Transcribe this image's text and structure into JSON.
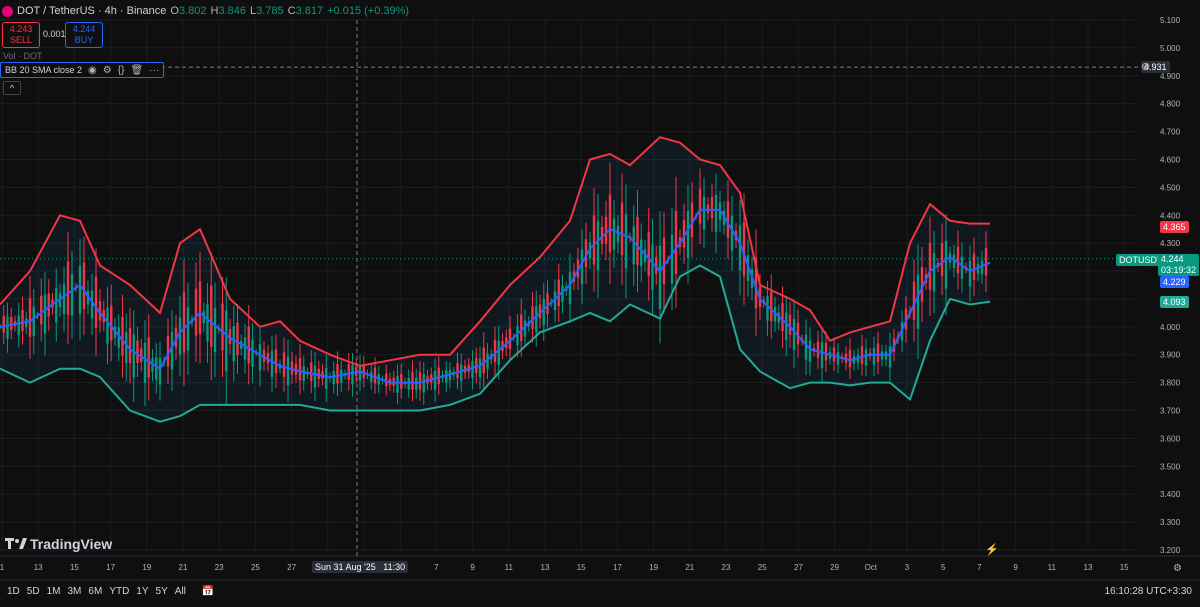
{
  "header": {
    "symbol": "DOT / TetherUS · 4h · Binance",
    "ohlc": [
      {
        "label": "O",
        "value": "3.802"
      },
      {
        "label": "H",
        "value": "3.846"
      },
      {
        "label": "L",
        "value": "3.785"
      },
      {
        "label": "C",
        "value": "3.817"
      }
    ],
    "change": "+0.015 (+0.39%)",
    "sell_price": "4.243",
    "sell_label": "SELL",
    "spread": "0.001",
    "buy_price": "4.244",
    "buy_label": "BUY",
    "volume_label": "Vol · DOT",
    "indicator_label": "BB 20 SMA close 2"
  },
  "price_labels": {
    "symbol_tag": "DOTUSDT",
    "last": "4.244",
    "countdown": "03:19:32",
    "upper": "4.365",
    "middle": "4.229",
    "lower": "4.093",
    "crosshair": "4.931"
  },
  "bottom": {
    "ranges": [
      "1D",
      "5D",
      "1M",
      "3M",
      "6M",
      "YTD",
      "1Y",
      "5Y",
      "All"
    ],
    "clock": "16:10:28 UTC+3:30",
    "crosshair_date": "Sun 31 Aug '25",
    "crosshair_time": "11:30"
  },
  "brand": "TradingView",
  "colors": {
    "upper": "#f23645",
    "middle": "#2962ff",
    "lower": "#22ab94",
    "up": "#089981",
    "down": "#f23645"
  },
  "chart_data": {
    "type": "line",
    "y_ticks": [
      "5.100",
      "5.000",
      "4.900",
      "4.800",
      "4.700",
      "4.600",
      "4.500",
      "4.400",
      "4.300",
      "4.200",
      "4.100",
      "4.000",
      "3.900",
      "3.800",
      "3.700",
      "3.600",
      "3.500",
      "3.400",
      "3.300",
      "3.200"
    ],
    "ylim": [
      3.2,
      5.1
    ],
    "x_ticks": [
      "1",
      "13",
      "15",
      "17",
      "19",
      "21",
      "23",
      "25",
      "27",
      "Sun 31 Aug '25",
      "3",
      "5",
      "7",
      "9",
      "11",
      "13",
      "15",
      "17",
      "19",
      "21",
      "23",
      "25",
      "27",
      "29",
      "Oct",
      "3",
      "5",
      "7",
      "9",
      "11",
      "13",
      "15"
    ],
    "x": [
      0,
      30,
      60,
      80,
      100,
      130,
      160,
      180,
      200,
      230,
      260,
      280,
      300,
      330,
      360,
      390,
      420,
      450,
      480,
      510,
      540,
      570,
      590,
      610,
      630,
      660,
      680,
      700,
      720,
      740,
      760,
      790,
      810,
      830,
      850,
      870,
      890,
      910,
      930,
      950,
      970,
      990
    ],
    "series": [
      {
        "name": "Upper",
        "values": [
          4.08,
          4.2,
          4.4,
          4.38,
          4.22,
          4.15,
          4.05,
          4.3,
          4.35,
          4.1,
          4.0,
          4.02,
          3.95,
          3.9,
          3.86,
          3.88,
          3.9,
          3.9,
          4.02,
          4.15,
          4.25,
          4.38,
          4.6,
          4.62,
          4.58,
          4.68,
          4.66,
          4.6,
          4.58,
          4.48,
          4.15,
          4.1,
          4.06,
          3.95,
          3.98,
          4.0,
          4.02,
          4.3,
          4.44,
          4.38,
          4.37,
          4.37
        ]
      },
      {
        "name": "Basis",
        "values": [
          4.0,
          4.02,
          4.1,
          4.15,
          4.05,
          3.92,
          3.85,
          3.98,
          4.05,
          3.96,
          3.9,
          3.86,
          3.84,
          3.82,
          3.84,
          3.8,
          3.8,
          3.83,
          3.86,
          3.95,
          4.05,
          4.15,
          4.28,
          4.35,
          4.32,
          4.2,
          4.3,
          4.42,
          4.42,
          4.3,
          4.1,
          4.0,
          3.92,
          3.9,
          3.88,
          3.9,
          3.9,
          4.05,
          4.2,
          4.25,
          4.2,
          4.23
        ]
      },
      {
        "name": "Lower",
        "values": [
          3.85,
          3.8,
          3.85,
          3.85,
          3.82,
          3.7,
          3.66,
          3.68,
          3.72,
          3.72,
          3.72,
          3.72,
          3.72,
          3.7,
          3.7,
          3.7,
          3.7,
          3.72,
          3.76,
          3.88,
          3.98,
          4.02,
          4.05,
          4.02,
          4.08,
          4.03,
          4.18,
          4.22,
          4.18,
          3.92,
          3.84,
          3.78,
          3.8,
          3.8,
          3.79,
          3.8,
          3.8,
          3.74,
          3.95,
          4.1,
          4.08,
          4.09
        ]
      }
    ]
  }
}
